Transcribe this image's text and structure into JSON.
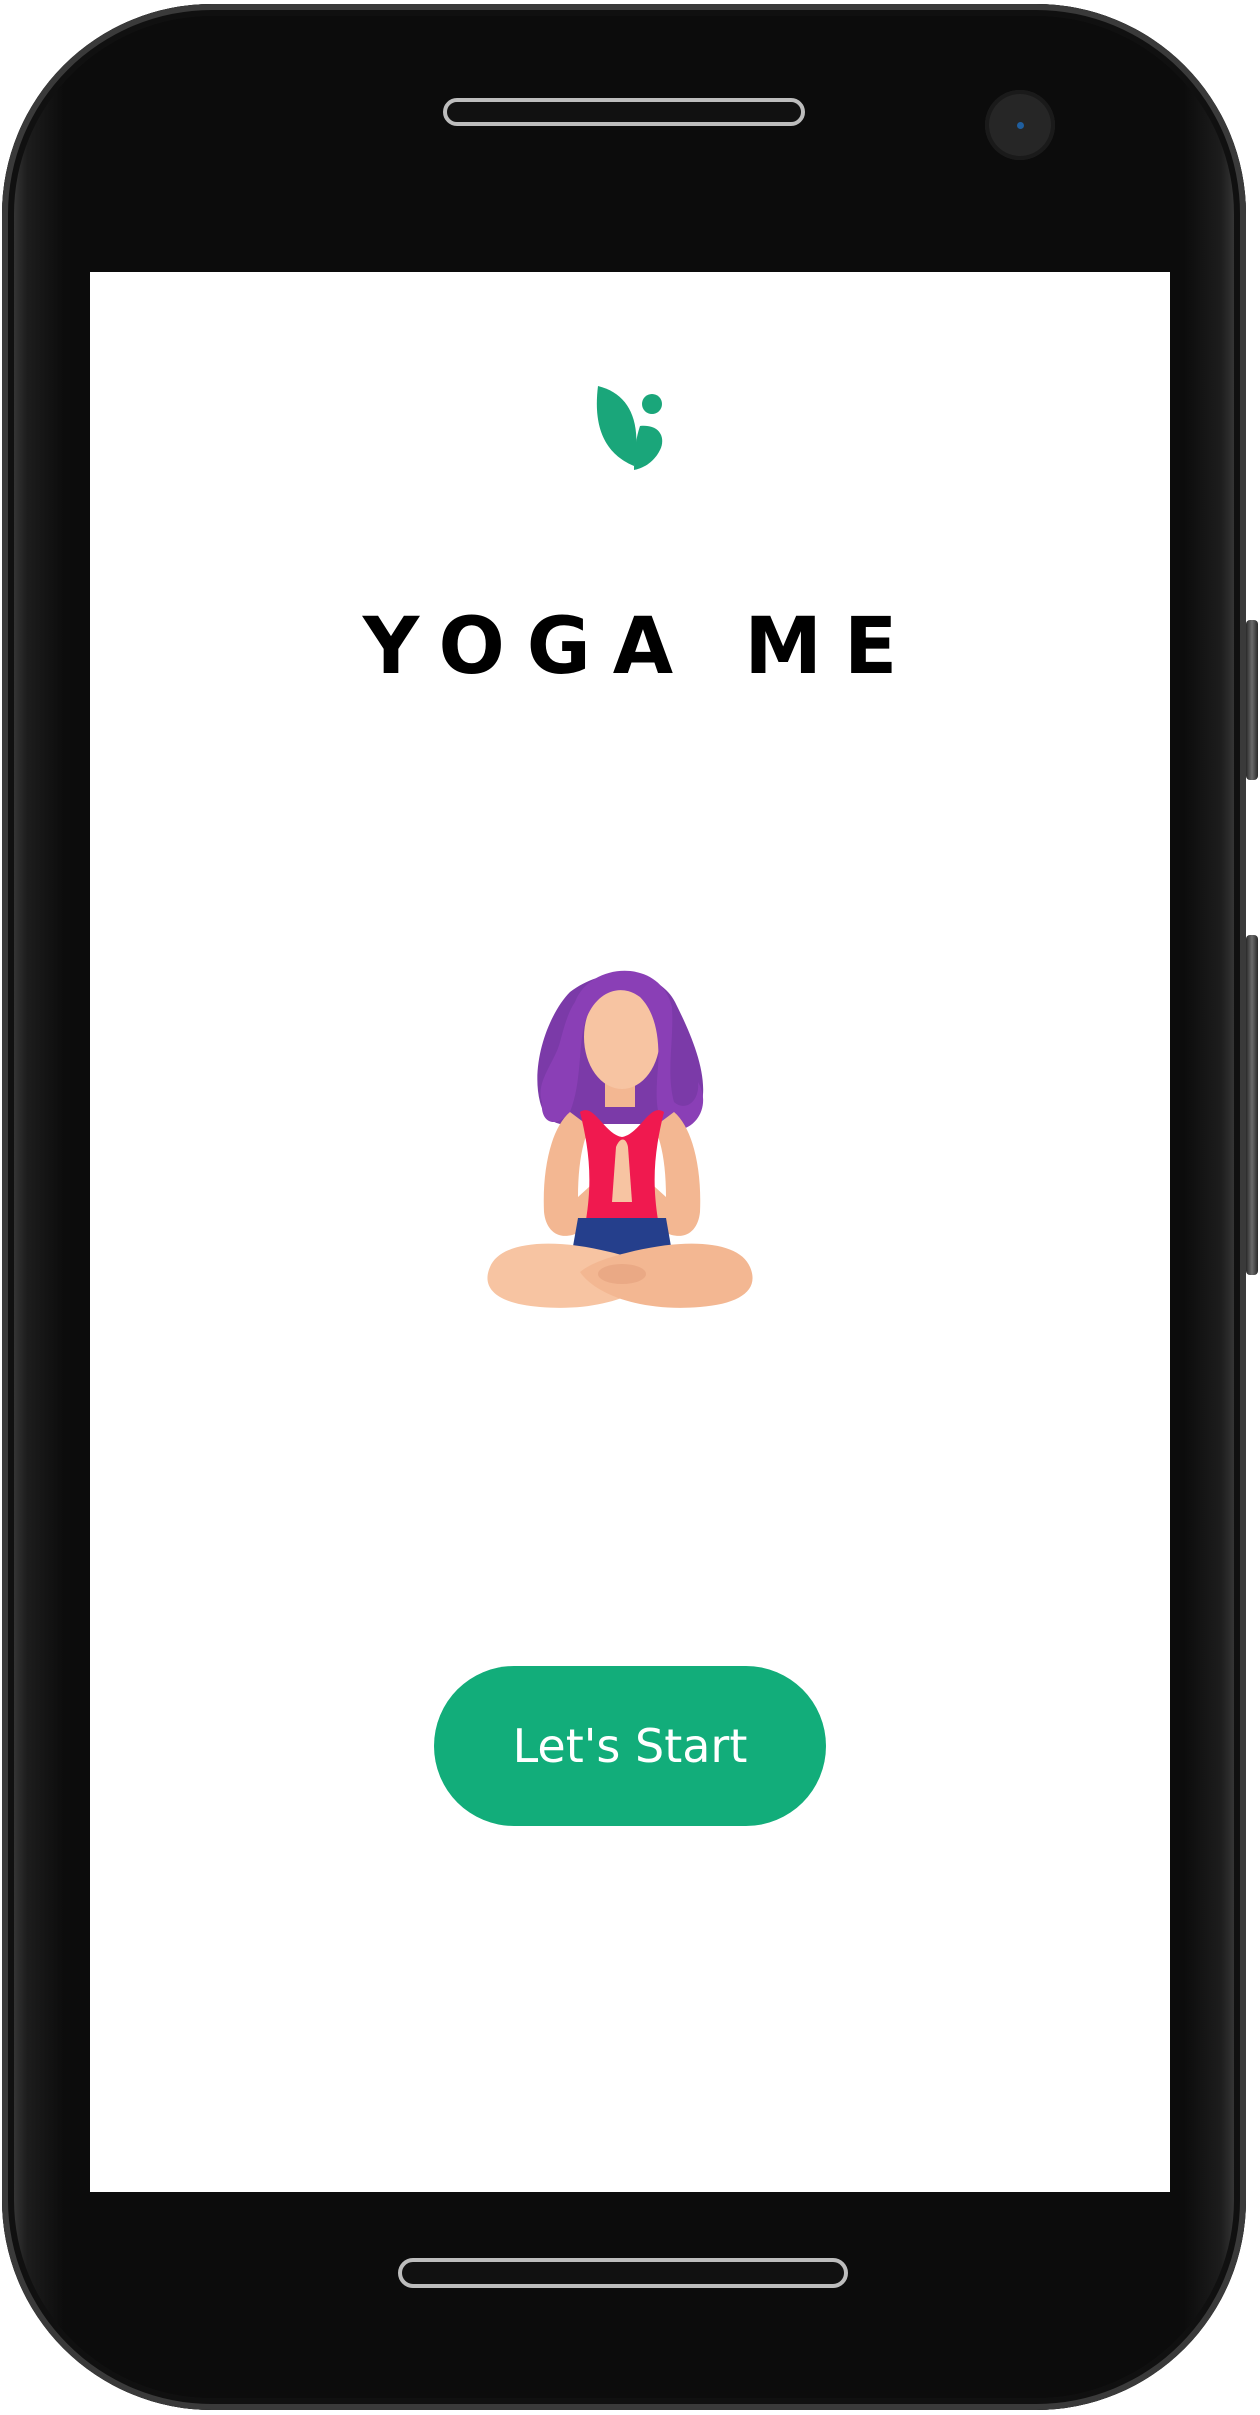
{
  "app": {
    "title": "YOGA ME",
    "accent_color": "#12ad7a"
  },
  "logo": {
    "icon": "leaf-person-logo-icon"
  },
  "illustration": {
    "icon": "meditating-woman-illustration"
  },
  "actions": {
    "start_label": "Let's Start"
  },
  "device": {
    "speaker": "speaker-grille",
    "camera": "front-camera-icon",
    "home": "home-bar"
  }
}
